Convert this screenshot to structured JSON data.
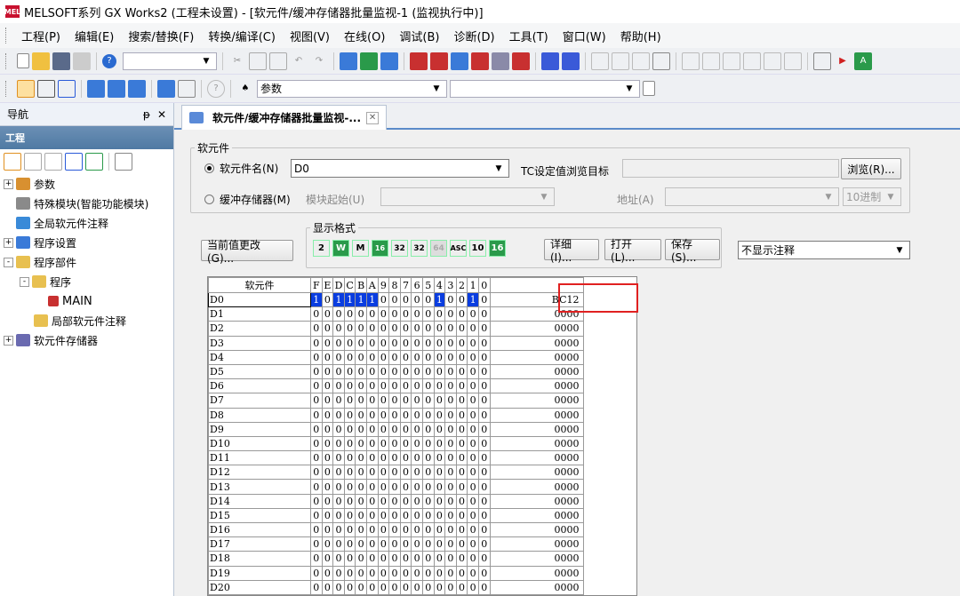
{
  "window": {
    "title": "MELSOFT系列 GX Works2 (工程未设置) - [软元件/缓冲存储器批量监视-1 (监视执行中)]",
    "icon_text": "MEL"
  },
  "menu": [
    "工程(P)",
    "编辑(E)",
    "搜索/替换(F)",
    "转换/编译(C)",
    "视图(V)",
    "在线(O)",
    "调试(B)",
    "诊断(D)",
    "工具(T)",
    "窗口(W)",
    "帮助(H)"
  ],
  "toolbar2": {
    "combo_value": "参数"
  },
  "nav": {
    "title": "导航",
    "pin": "ᵽ",
    "close": "✕",
    "project_label": "工程",
    "tree": [
      {
        "label": "参数",
        "level": 0,
        "toggle": "+"
      },
      {
        "label": "特殊模块(智能功能模块)",
        "level": 1,
        "toggle": ""
      },
      {
        "label": "全局软元件注释",
        "level": 1,
        "toggle": ""
      },
      {
        "label": "程序设置",
        "level": 0,
        "toggle": "+"
      },
      {
        "label": "程序部件",
        "level": 0,
        "toggle": "-"
      },
      {
        "label": "程序",
        "level": 1,
        "toggle": "-"
      },
      {
        "label": "MAIN",
        "level": 2,
        "toggle": ""
      },
      {
        "label": "局部软元件注释",
        "level": 1,
        "toggle": ""
      },
      {
        "label": "软元件存储器",
        "level": 0,
        "toggle": "+"
      }
    ]
  },
  "tab": {
    "label": "软元件/缓冲存储器批量监视-...",
    "close": "✕"
  },
  "device_group": {
    "legend": "软元件",
    "device_name_label": "软元件名(N)",
    "device_name_value": "D0",
    "buffer_label": "缓冲存储器(M)",
    "module_start_label": "模块起始(U)",
    "tc_label": "TC设定值浏览目标",
    "browse_button": "浏览(R)...",
    "address_label": "地址(A)",
    "radix_value": "10进制"
  },
  "display_group": {
    "legend": "显示格式",
    "format_buttons": [
      "2",
      "W",
      "M",
      "16",
      "32",
      "32",
      "64",
      "ASC",
      "10",
      "16"
    ],
    "detail_button": "详细(I)...",
    "open_button": "打开(L)...",
    "save_button": "保存(S)..."
  },
  "change_value_button": "当前值更改(G)...",
  "comment_combo": "不显示注释",
  "grid": {
    "header_device": "软元件",
    "bit_headers": [
      "F",
      "E",
      "D",
      "C",
      "B",
      "A",
      "9",
      "8",
      "7",
      "6",
      "5",
      "4",
      "3",
      "2",
      "1",
      "0"
    ],
    "rows": [
      {
        "device": "D0",
        "bits": [
          1,
          0,
          1,
          1,
          1,
          1,
          0,
          0,
          0,
          0,
          0,
          1,
          0,
          0,
          1,
          0
        ],
        "value": "BC12"
      },
      {
        "device": "D1",
        "bits": [
          0,
          0,
          0,
          0,
          0,
          0,
          0,
          0,
          0,
          0,
          0,
          0,
          0,
          0,
          0,
          0
        ],
        "value": "0000"
      },
      {
        "device": "D2",
        "bits": [
          0,
          0,
          0,
          0,
          0,
          0,
          0,
          0,
          0,
          0,
          0,
          0,
          0,
          0,
          0,
          0
        ],
        "value": "0000"
      },
      {
        "device": "D3",
        "bits": [
          0,
          0,
          0,
          0,
          0,
          0,
          0,
          0,
          0,
          0,
          0,
          0,
          0,
          0,
          0,
          0
        ],
        "value": "0000"
      },
      {
        "device": "D4",
        "bits": [
          0,
          0,
          0,
          0,
          0,
          0,
          0,
          0,
          0,
          0,
          0,
          0,
          0,
          0,
          0,
          0
        ],
        "value": "0000"
      },
      {
        "device": "D5",
        "bits": [
          0,
          0,
          0,
          0,
          0,
          0,
          0,
          0,
          0,
          0,
          0,
          0,
          0,
          0,
          0,
          0
        ],
        "value": "0000"
      },
      {
        "device": "D6",
        "bits": [
          0,
          0,
          0,
          0,
          0,
          0,
          0,
          0,
          0,
          0,
          0,
          0,
          0,
          0,
          0,
          0
        ],
        "value": "0000"
      },
      {
        "device": "D7",
        "bits": [
          0,
          0,
          0,
          0,
          0,
          0,
          0,
          0,
          0,
          0,
          0,
          0,
          0,
          0,
          0,
          0
        ],
        "value": "0000"
      },
      {
        "device": "D8",
        "bits": [
          0,
          0,
          0,
          0,
          0,
          0,
          0,
          0,
          0,
          0,
          0,
          0,
          0,
          0,
          0,
          0
        ],
        "value": "0000"
      },
      {
        "device": "D9",
        "bits": [
          0,
          0,
          0,
          0,
          0,
          0,
          0,
          0,
          0,
          0,
          0,
          0,
          0,
          0,
          0,
          0
        ],
        "value": "0000"
      },
      {
        "device": "D10",
        "bits": [
          0,
          0,
          0,
          0,
          0,
          0,
          0,
          0,
          0,
          0,
          0,
          0,
          0,
          0,
          0,
          0
        ],
        "value": "0000"
      },
      {
        "device": "D11",
        "bits": [
          0,
          0,
          0,
          0,
          0,
          0,
          0,
          0,
          0,
          0,
          0,
          0,
          0,
          0,
          0,
          0
        ],
        "value": "0000"
      },
      {
        "device": "D12",
        "bits": [
          0,
          0,
          0,
          0,
          0,
          0,
          0,
          0,
          0,
          0,
          0,
          0,
          0,
          0,
          0,
          0
        ],
        "value": "0000"
      },
      {
        "device": "D13",
        "bits": [
          0,
          0,
          0,
          0,
          0,
          0,
          0,
          0,
          0,
          0,
          0,
          0,
          0,
          0,
          0,
          0
        ],
        "value": "0000"
      },
      {
        "device": "D14",
        "bits": [
          0,
          0,
          0,
          0,
          0,
          0,
          0,
          0,
          0,
          0,
          0,
          0,
          0,
          0,
          0,
          0
        ],
        "value": "0000"
      },
      {
        "device": "D15",
        "bits": [
          0,
          0,
          0,
          0,
          0,
          0,
          0,
          0,
          0,
          0,
          0,
          0,
          0,
          0,
          0,
          0
        ],
        "value": "0000"
      },
      {
        "device": "D16",
        "bits": [
          0,
          0,
          0,
          0,
          0,
          0,
          0,
          0,
          0,
          0,
          0,
          0,
          0,
          0,
          0,
          0
        ],
        "value": "0000"
      },
      {
        "device": "D17",
        "bits": [
          0,
          0,
          0,
          0,
          0,
          0,
          0,
          0,
          0,
          0,
          0,
          0,
          0,
          0,
          0,
          0
        ],
        "value": "0000"
      },
      {
        "device": "D18",
        "bits": [
          0,
          0,
          0,
          0,
          0,
          0,
          0,
          0,
          0,
          0,
          0,
          0,
          0,
          0,
          0,
          0
        ],
        "value": "0000"
      },
      {
        "device": "D19",
        "bits": [
          0,
          0,
          0,
          0,
          0,
          0,
          0,
          0,
          0,
          0,
          0,
          0,
          0,
          0,
          0,
          0
        ],
        "value": "0000"
      },
      {
        "device": "D20",
        "bits": [
          0,
          0,
          0,
          0,
          0,
          0,
          0,
          0,
          0,
          0,
          0,
          0,
          0,
          0,
          0,
          0
        ],
        "value": "0000"
      }
    ]
  },
  "colors": {
    "bit_on": "#0a3de0",
    "highlight": "#e02020",
    "nav_header": "#5b84ad"
  }
}
